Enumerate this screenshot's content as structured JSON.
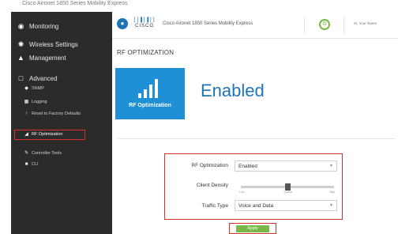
{
  "top_caption": "Cisco Aironet 1850 Series Mobility Express",
  "sidebar": {
    "items": [
      {
        "label": "Monitoring",
        "icon": "dashboard-icon"
      },
      {
        "label": "Wireless Settings",
        "icon": "wireless-icon"
      },
      {
        "label": "Management",
        "icon": "management-icon"
      },
      {
        "label": "Advanced",
        "icon": "advanced-icon"
      }
    ],
    "sub_items": [
      {
        "label": "SNMP",
        "icon": "snmp-icon"
      },
      {
        "label": "Logging",
        "icon": "logging-icon"
      },
      {
        "label": "Reset to Factory Defaults",
        "icon": "reset-icon"
      },
      {
        "label": "RF Optimization",
        "icon": "rf-optimization-icon",
        "active": true
      },
      {
        "label": "Controller Tools",
        "icon": "tools-icon"
      },
      {
        "label": "CLI",
        "icon": "cli-icon"
      }
    ]
  },
  "header": {
    "logo_text": "CISCO",
    "title": "Cisco Aironet 1850 Series Mobility Express",
    "right_text": "Hi, Your Name"
  },
  "main": {
    "page_title": "RF OPTIMIZATION",
    "tile_label": "RF Optimization",
    "tile_status": "Enabled",
    "form": {
      "rf_optimization_label": "RF Optimization",
      "rf_optimization_value": "Enabled",
      "client_density_label": "Client Density",
      "client_density_ticks": [
        "Low",
        "Typical",
        "High"
      ],
      "client_density_level": 0.5,
      "traffic_type_label": "Traffic Type",
      "traffic_type_value": "Voice and Data"
    },
    "apply_label": "Apply"
  },
  "colors": {
    "accent_blue": "#1f8fd6",
    "sidebar_bg": "#2b2b2b",
    "highlight_red": "#d9302c",
    "apply_green": "#7ab648"
  }
}
